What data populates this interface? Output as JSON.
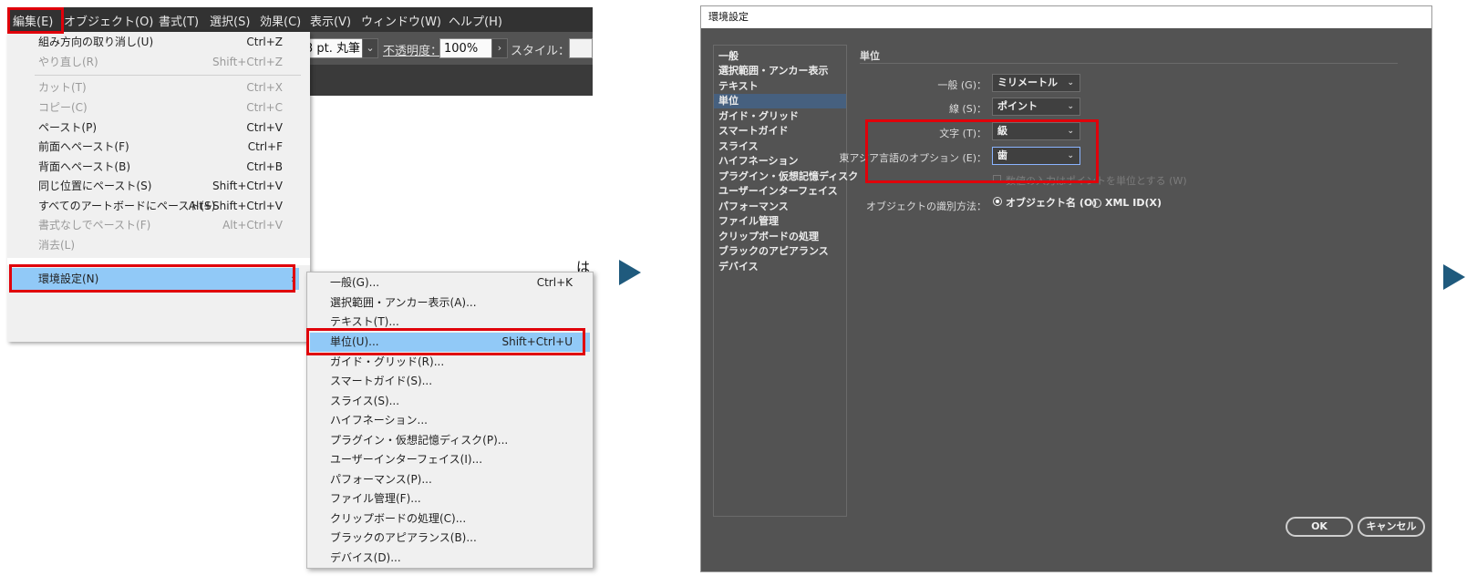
{
  "menubar": {
    "items": [
      "編集(E)",
      "オブジェクト(O)",
      "書式(T)",
      "選択(S)",
      "効果(C)",
      "表示(V)",
      "ウィンドウ(W)",
      "ヘルプ(H)"
    ]
  },
  "control_bar": {
    "brush_value": "3 pt. 丸筆",
    "opacity_label": "不透明度：",
    "opacity_value": "100%",
    "style_label": "スタイル："
  },
  "edit_menu": {
    "items": [
      {
        "label": "組み方向の取り消し(U)",
        "shortcut": "Ctrl+Z"
      },
      {
        "label": "やり直し(R)",
        "shortcut": "Shift+Ctrl+Z"
      },
      {
        "label": "カット(T)",
        "shortcut": "Ctrl+X"
      },
      {
        "label": "コピー(C)",
        "shortcut": "Ctrl+C"
      },
      {
        "label": "ペースト(P)",
        "shortcut": "Ctrl+V"
      },
      {
        "label": "前面へペースト(F)",
        "shortcut": "Ctrl+F"
      },
      {
        "label": "背面へペースト(B)",
        "shortcut": "Ctrl+B"
      },
      {
        "label": "同じ位置にペースト(S)",
        "shortcut": "Shift+Ctrl+V"
      },
      {
        "label": "すべてのアートボードにペースト(S)",
        "shortcut": "Alt+Shift+Ctrl+V"
      },
      {
        "label": "書式なしでペースト(F)",
        "shortcut": "Alt+Ctrl+V"
      },
      {
        "label": "消去(L)",
        "shortcut": ""
      }
    ],
    "preferences_label": "環境設定(N)",
    "submenu_arrow": "›"
  },
  "preferences_submenu": {
    "items": [
      {
        "label": "一般(G)...",
        "shortcut": "Ctrl+K"
      },
      {
        "label": "選択範囲・アンカー表示(A)...",
        "shortcut": ""
      },
      {
        "label": "テキスト(T)...",
        "shortcut": ""
      },
      {
        "label": "単位(U)...",
        "shortcut": "Shift+Ctrl+U"
      },
      {
        "label": "ガイド・グリッド(R)...",
        "shortcut": ""
      },
      {
        "label": "スマートガイド(S)...",
        "shortcut": ""
      },
      {
        "label": "スライス(S)...",
        "shortcut": ""
      },
      {
        "label": "ハイフネーション...",
        "shortcut": ""
      },
      {
        "label": "プラグイン・仮想記憶ディスク(P)...",
        "shortcut": ""
      },
      {
        "label": "ユーザーインターフェイス(I)...",
        "shortcut": ""
      },
      {
        "label": "パフォーマンス(P)...",
        "shortcut": ""
      },
      {
        "label": "ファイル管理(F)...",
        "shortcut": ""
      },
      {
        "label": "クリップボードの処理(C)...",
        "shortcut": ""
      },
      {
        "label": "ブラックのアピアランス(B)...",
        "shortcut": ""
      },
      {
        "label": "デバイス(D)...",
        "shortcut": ""
      }
    ]
  },
  "canvas_peek": {
    "char": "は"
  },
  "dialog": {
    "title": "環境設定",
    "nav": [
      "一般",
      "選択範囲・アンカー表示",
      "テキスト",
      "単位",
      "ガイド・グリッド",
      "スマートガイド",
      "スライス",
      "ハイフネーション",
      "プラグイン・仮想記憶ディスク",
      "ユーザーインターフェイス",
      "パフォーマンス",
      "ファイル管理",
      "クリップボードの処理",
      "ブラックのアピアランス",
      "デバイス"
    ],
    "section_title": "単位",
    "fields": {
      "general_label": "一般 (G)：",
      "general_value": "ミリメートル",
      "stroke_label": "線 (S)：",
      "stroke_value": "ポイント",
      "type_label": "文字 (T)：",
      "type_value": "級",
      "asian_label": "東アジア言語のオプション (E)：",
      "asian_value": "歯"
    },
    "checkbox_label": "数値の入力はポイントを単位とする (W)",
    "identify_label": "オブジェクトの識別方法：",
    "radio_object": "オブジェクト名 (O)",
    "radio_xml": "XML ID(X)",
    "ok": "OK",
    "cancel": "キャンセル"
  },
  "colors": {
    "highlight": "#91c9f7",
    "red_outline": "#e0000a",
    "arrow": "#1f5a7d",
    "dialog_bg": "#535353"
  }
}
